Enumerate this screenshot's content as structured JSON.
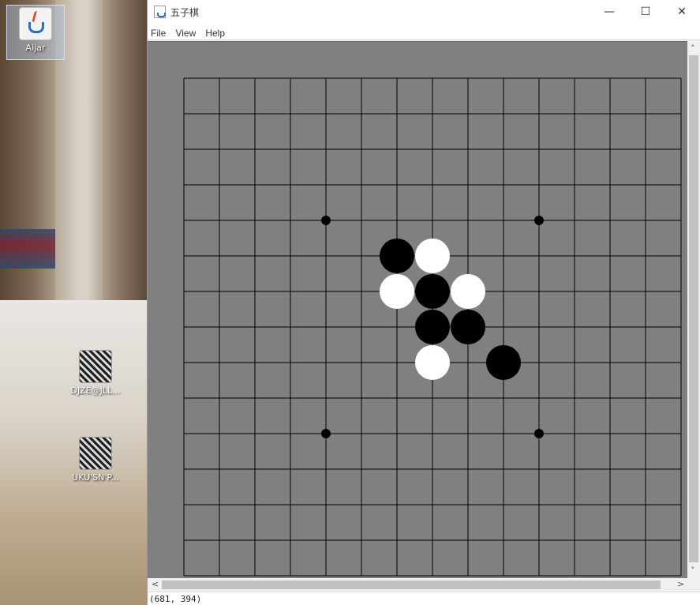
{
  "desktop": {
    "icons": [
      {
        "label": "Aijar",
        "icon": "java-icon"
      },
      {
        "label": "DJZE@JLL...",
        "icon": "file-icon"
      },
      {
        "label": "UKU'SN'P...",
        "icon": "file-icon"
      }
    ]
  },
  "window": {
    "title": "五子棋",
    "controls": {
      "minimize": "—",
      "maximize": "☐",
      "close": "✕"
    },
    "menu": [
      "File",
      "View",
      "Help"
    ],
    "status": "(681, 394)"
  },
  "board": {
    "grid_size": 15,
    "background": "#808080",
    "line_color": "#000000",
    "star_points": [
      [
        4,
        4
      ],
      [
        10,
        4
      ],
      [
        4,
        10
      ],
      [
        10,
        10
      ]
    ],
    "stones": [
      {
        "col": 6,
        "row": 5,
        "color": "black"
      },
      {
        "col": 7,
        "row": 5,
        "color": "white"
      },
      {
        "col": 6,
        "row": 6,
        "color": "white"
      },
      {
        "col": 7,
        "row": 6,
        "color": "black"
      },
      {
        "col": 8,
        "row": 6,
        "color": "white"
      },
      {
        "col": 7,
        "row": 7,
        "color": "black"
      },
      {
        "col": 8,
        "row": 7,
        "color": "black"
      },
      {
        "col": 7,
        "row": 8,
        "color": "white"
      },
      {
        "col": 9,
        "row": 8,
        "color": "black"
      }
    ]
  }
}
